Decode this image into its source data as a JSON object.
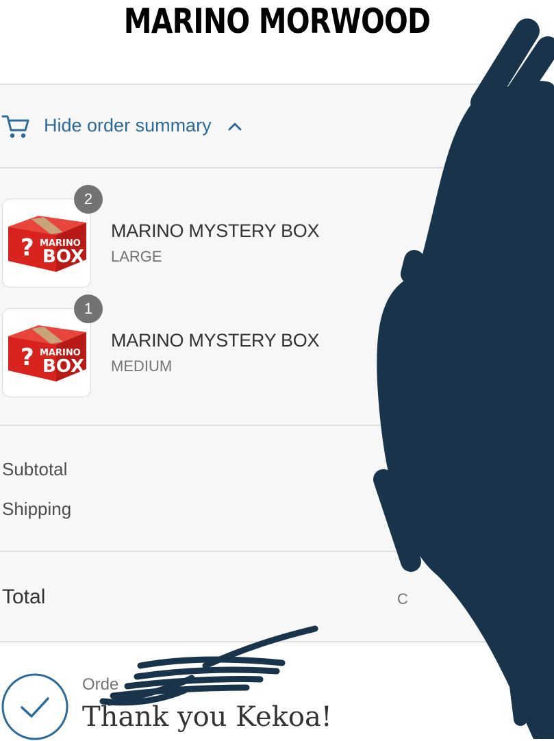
{
  "store": {
    "title": "MARINO MORWOOD"
  },
  "summary": {
    "toggle_label": "Hide order summary",
    "items": [
      {
        "name": "MARINO MYSTERY BOX",
        "variant": "LARGE",
        "quantity": "2",
        "image_text": [
          "MARINO",
          "BOX"
        ],
        "image_symbol": "?"
      },
      {
        "name": "MARINO MYSTERY BOX",
        "variant": "MEDIUM",
        "quantity": "1",
        "image_text": [
          "MARINO",
          "BOX"
        ],
        "image_symbol": "?"
      }
    ],
    "subtotal_label": "Subtotal",
    "shipping_label": "Shipping",
    "total_label": "Total",
    "total_currency_partial": "C"
  },
  "confirmation": {
    "order_label_partial": "Orde",
    "thanks": "Thank you Kekoa!"
  },
  "colors": {
    "accent": "#2b6a9a",
    "panel_bg": "#f7f7f7",
    "badge_bg": "#737373",
    "box_red": "#d8231f",
    "redaction": "#19344a"
  },
  "icons": [
    "cart-icon",
    "chevron-up-icon",
    "checkmark-circle-icon"
  ]
}
